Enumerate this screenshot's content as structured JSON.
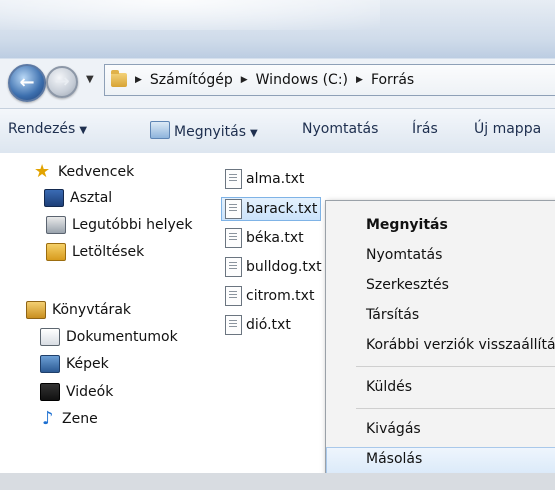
{
  "address_bar": {
    "breadcrumbs": [
      "Számítógép",
      "Windows (C:)",
      "Forrás"
    ]
  },
  "toolbar": {
    "organize": "Rendezés",
    "open": "Megnyitás",
    "print": "Nyomtatás",
    "burn": "Írás",
    "new_folder": "Új mappa"
  },
  "sidebar": {
    "favorites": {
      "label": "Kedvencek",
      "items": [
        "Asztal",
        "Legutóbbi helyek",
        "Letöltések"
      ]
    },
    "libraries": {
      "label": "Könyvtárak",
      "items": [
        "Dokumentumok",
        "Képek",
        "Videók",
        "Zene"
      ]
    }
  },
  "files": [
    "alma.txt",
    "barack.txt",
    "béka.txt",
    "bulldog.txt",
    "citrom.txt",
    "dió.txt"
  ],
  "selected_file": "barack.txt",
  "context_menu": {
    "items": [
      "Megnyitás",
      "Nyomtatás",
      "Szerkesztés",
      "Társítás",
      "Korábbi verziók visszaállítása",
      "Küldés",
      "Kivágás",
      "Másolás"
    ],
    "default_item": "Megnyitás",
    "hovered_item": "Másolás"
  },
  "icons": {
    "back": "back-arrow-icon",
    "forward": "forward-arrow-icon",
    "favorites": "star-icon",
    "file": "text-file-icon"
  },
  "colors": {
    "toolbar_text": "#1e2f4f",
    "selection": "#cbe3fb"
  }
}
